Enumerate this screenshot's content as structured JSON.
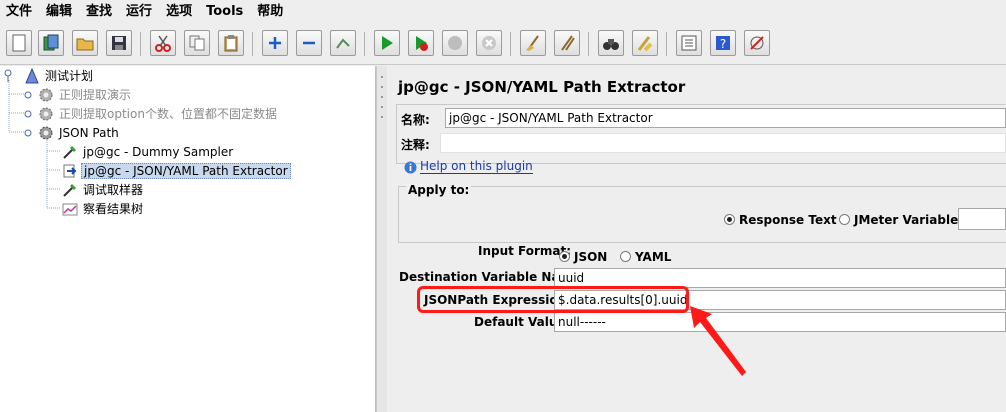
{
  "menu": [
    "文件",
    "编辑",
    "查找",
    "运行",
    "选项",
    "Tools",
    "帮助"
  ],
  "toolbar": {
    "buttons": [
      "new-icon",
      "templates-icon",
      "open-icon",
      "save-icon",
      "cut-icon",
      "copy-icon",
      "paste-icon",
      "expand-icon",
      "collapse-icon",
      "toggle-icon",
      "start-icon",
      "start-no-pause-icon",
      "stop-icon",
      "shutdown-icon",
      "clear-icon",
      "clear-all-icon",
      "search-icon",
      "reset-search-icon",
      "function-helper-icon",
      "help-icon",
      "remote-icon"
    ]
  },
  "tree": {
    "root": "测试计划",
    "children": [
      {
        "label": "正则提取演示",
        "disabled": true
      },
      {
        "label": "正则提取option个数、位置都不固定数据",
        "disabled": true
      },
      {
        "label": "JSON Path",
        "disabled": false
      }
    ],
    "json_path_children": [
      {
        "label": "jp@gc - Dummy Sampler",
        "selected": false
      },
      {
        "label": "jp@gc - JSON/YAML Path Extractor",
        "selected": true
      },
      {
        "label": "调试取样器",
        "selected": false
      },
      {
        "label": "察看结果树",
        "selected": false
      }
    ]
  },
  "panel": {
    "title": "jp@gc - JSON/YAML Path Extractor",
    "name_label": "名称:",
    "name_value": "jp@gc - JSON/YAML Path Extractor",
    "comment_label": "注释:",
    "comment_value": "",
    "help_link": "Help on this plugin",
    "apply_to": {
      "legend": "Apply to:",
      "option_response": "Response Text",
      "option_variable": "JMeter Variable:",
      "selected": "Response Text",
      "variable_value": ""
    },
    "input_format": {
      "label": "Input Format:",
      "option_json": "JSON",
      "option_yaml": "YAML",
      "selected": "JSON"
    },
    "dest_var_label": "Destination Variable Name:",
    "dest_var_value": "uuid",
    "jsonpath_label": "JSONPath Expression:",
    "jsonpath_value": "$.data.results[0].uuid",
    "default_label": "Default Value:",
    "default_value": "null------"
  },
  "annotation": {
    "color": "#ff1a1a"
  }
}
